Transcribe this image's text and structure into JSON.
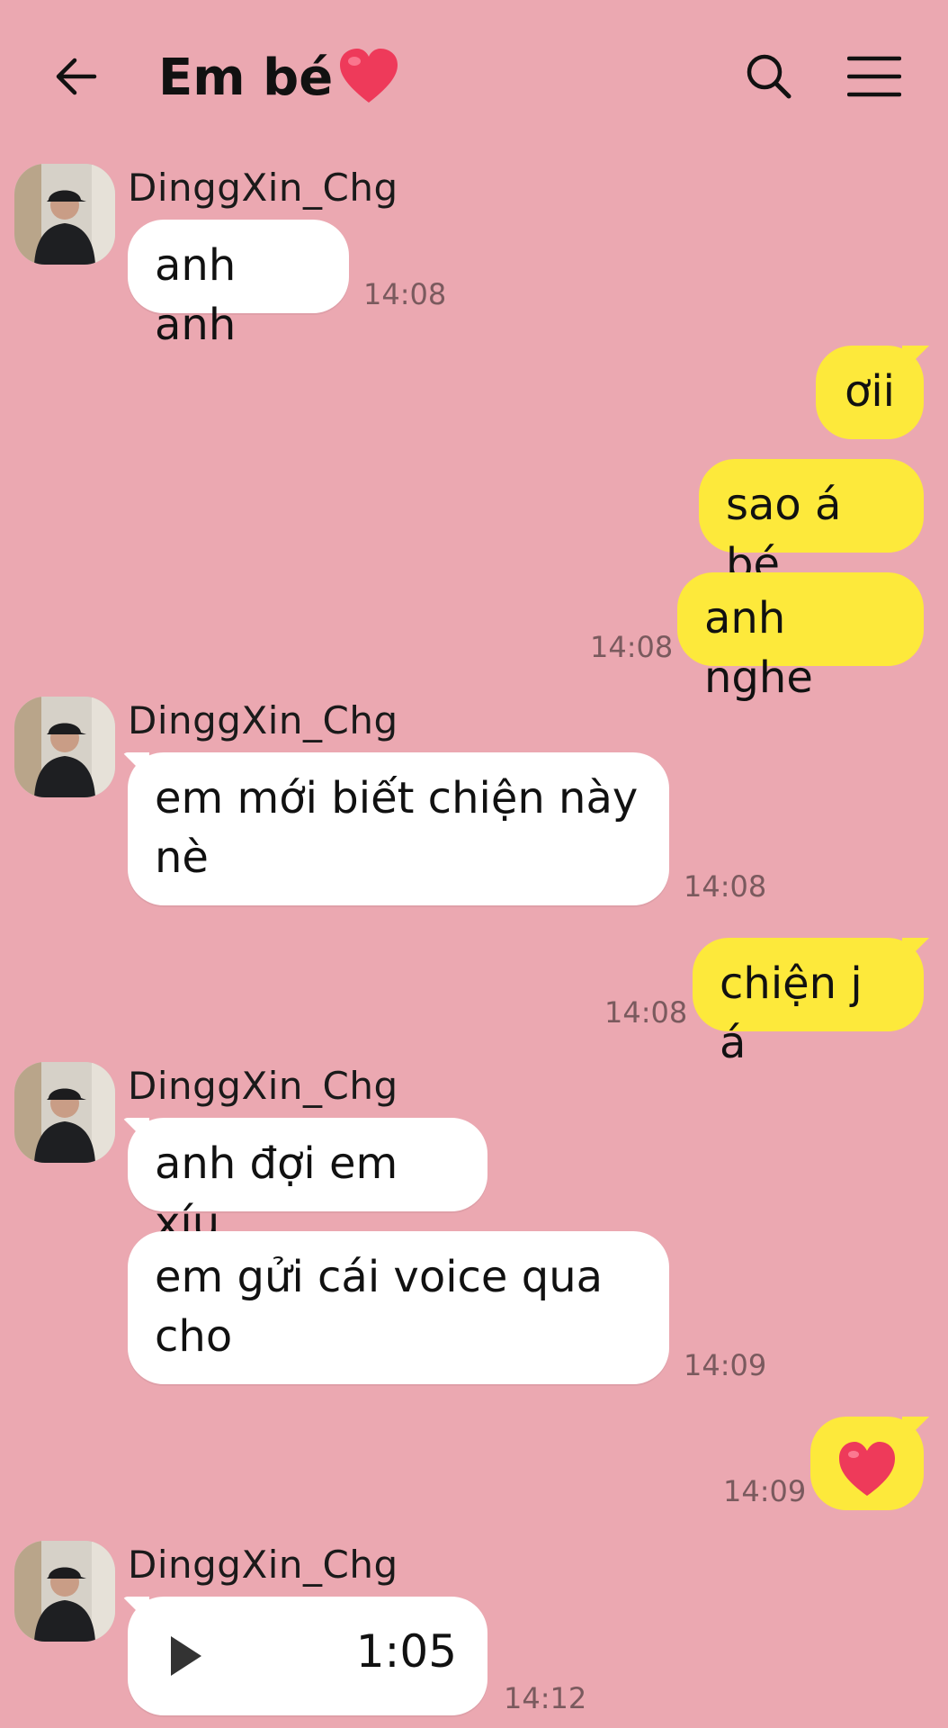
{
  "header": {
    "title": "Em bé",
    "title_emoji": "heart-icon",
    "back_icon": "arrow-left-icon",
    "search_icon": "search-icon",
    "menu_icon": "menu-icon"
  },
  "colors": {
    "background": "#eba8b1",
    "incoming_bubble": "#ffffff",
    "outgoing_bubble": "#fde93b",
    "heart": "#ee3a5a"
  },
  "messages": [
    {
      "sender": "DinggXin_Chg",
      "text": "anh anh",
      "time": "14:08"
    },
    {
      "text": "ơii"
    },
    {
      "text": "sao á bé"
    },
    {
      "text": "anh nghe",
      "time": "14:08"
    },
    {
      "sender": "DinggXin_Chg",
      "text": "em mới biết chiện này nè",
      "time": "14:08"
    },
    {
      "text": "chiện j á",
      "time": "14:08"
    },
    {
      "sender": "DinggXin_Chg",
      "text": "anh đợi em xíu"
    },
    {
      "text": "em gửi cái voice qua cho",
      "time": "14:09"
    },
    {
      "emoji": "heart-icon",
      "time": "14:09"
    },
    {
      "sender": "DinggXin_Chg",
      "voice_duration": "1:05",
      "time": "14:12"
    }
  ]
}
